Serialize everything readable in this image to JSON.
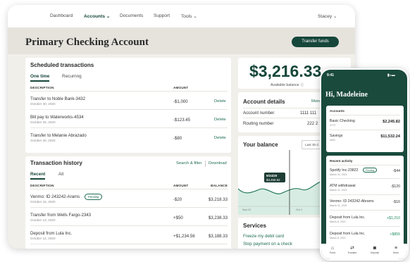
{
  "nav": {
    "items": [
      "Dashboard",
      "Accounts",
      "Documents",
      "Support",
      "Tools"
    ],
    "user": "Stacey"
  },
  "header": {
    "title": "Primary Checking Account",
    "transfer_label": "Transfer funds"
  },
  "scheduled": {
    "title": "Scheduled transactions",
    "tabs": [
      "One time",
      "Recurring"
    ],
    "columns": [
      "DESCRIPTION",
      "AMOUNT"
    ],
    "action_label": "Delete",
    "rows": [
      {
        "desc": "Transfer to Noble Bank-3432",
        "date": "October 30, 2020",
        "amount": "-$1,000"
      },
      {
        "desc": "Bill pay to Waterworks-4534",
        "date": "October 25, 2020",
        "amount": "-$123.45"
      },
      {
        "desc": "Transfer to Melanie Abrazado",
        "date": "October 20, 2020",
        "amount": "-$80"
      }
    ]
  },
  "history": {
    "title": "Transaction history",
    "search_label": "Search & filter",
    "download_label": "Download",
    "tabs": [
      "Recent",
      "All"
    ],
    "columns": [
      "DESCRIPTION",
      "AMOUNT",
      "BALANCE"
    ],
    "pending_label": "Pending",
    "rows": [
      {
        "desc": "Venmo: ID 243242-Arams",
        "date": "October 16, 2020",
        "amount": "-$20",
        "balance": "$3,218.33"
      },
      {
        "desc": "Transfer from Wells Fargo-2343",
        "date": "October 13, 2020",
        "amount": "+$50",
        "balance": "$3,238.33"
      },
      {
        "desc": "Deposit from Lula Inc.",
        "date": "October 12, 2020",
        "amount": "+$1,234.56",
        "balance": "$3,188.33"
      }
    ]
  },
  "balance": {
    "amount": "$3,216.33",
    "label": "Available balance ⓘ"
  },
  "details": {
    "title": "Account details",
    "more": "More",
    "rows": [
      {
        "label": "Account number",
        "value": "1111 111"
      },
      {
        "label": "Routing number",
        "value": "222 2"
      }
    ]
  },
  "your_balance": {
    "title": "Your balance",
    "range": "Last 30 d",
    "tooltip_date": "9/24/20",
    "tooltip_value": "$3,456.92",
    "x_labels": [
      "Sep 15",
      "Oct 1"
    ]
  },
  "services": {
    "title": "Services",
    "links": [
      "Freeze my debit card",
      "Stop payment on a check"
    ]
  },
  "phone": {
    "time": "9:41",
    "greeting": "Hi, Madeleine",
    "accounts_title": "Accounts",
    "accounts": [
      {
        "name": "Basic Checking",
        "number": "4773",
        "balance": "$2,245.82"
      },
      {
        "name": "Savings",
        "number": "0832",
        "balance": "$11,532.24"
      }
    ],
    "activity_title": "Recent activity",
    "activity": [
      {
        "name": "Spotify Inc-23822",
        "date": "March 11, 2021",
        "amount": "-$44",
        "pending": true
      },
      {
        "name": "ATM withdrawal",
        "date": "March 11, 2021",
        "amount": "-$120"
      },
      {
        "name": "Venmo: ID 243242-Abrams",
        "date": "March 11, 2021",
        "amount": "-$16"
      },
      {
        "name": "Deposit from Lula Inc.",
        "date": "March 8, 2021",
        "amount": "+$1,210"
      },
      {
        "name": "Deposit from Lula Inc.",
        "date": "March 6, 2021",
        "amount": "+$855"
      }
    ],
    "pending_label": "Pending",
    "bottom_nav": [
      "Feed",
      "Transfer",
      "Deposit",
      "More"
    ]
  },
  "colors": {
    "brand": "#16463a",
    "link": "#1d6b52",
    "page_bg": "#f1efea"
  }
}
